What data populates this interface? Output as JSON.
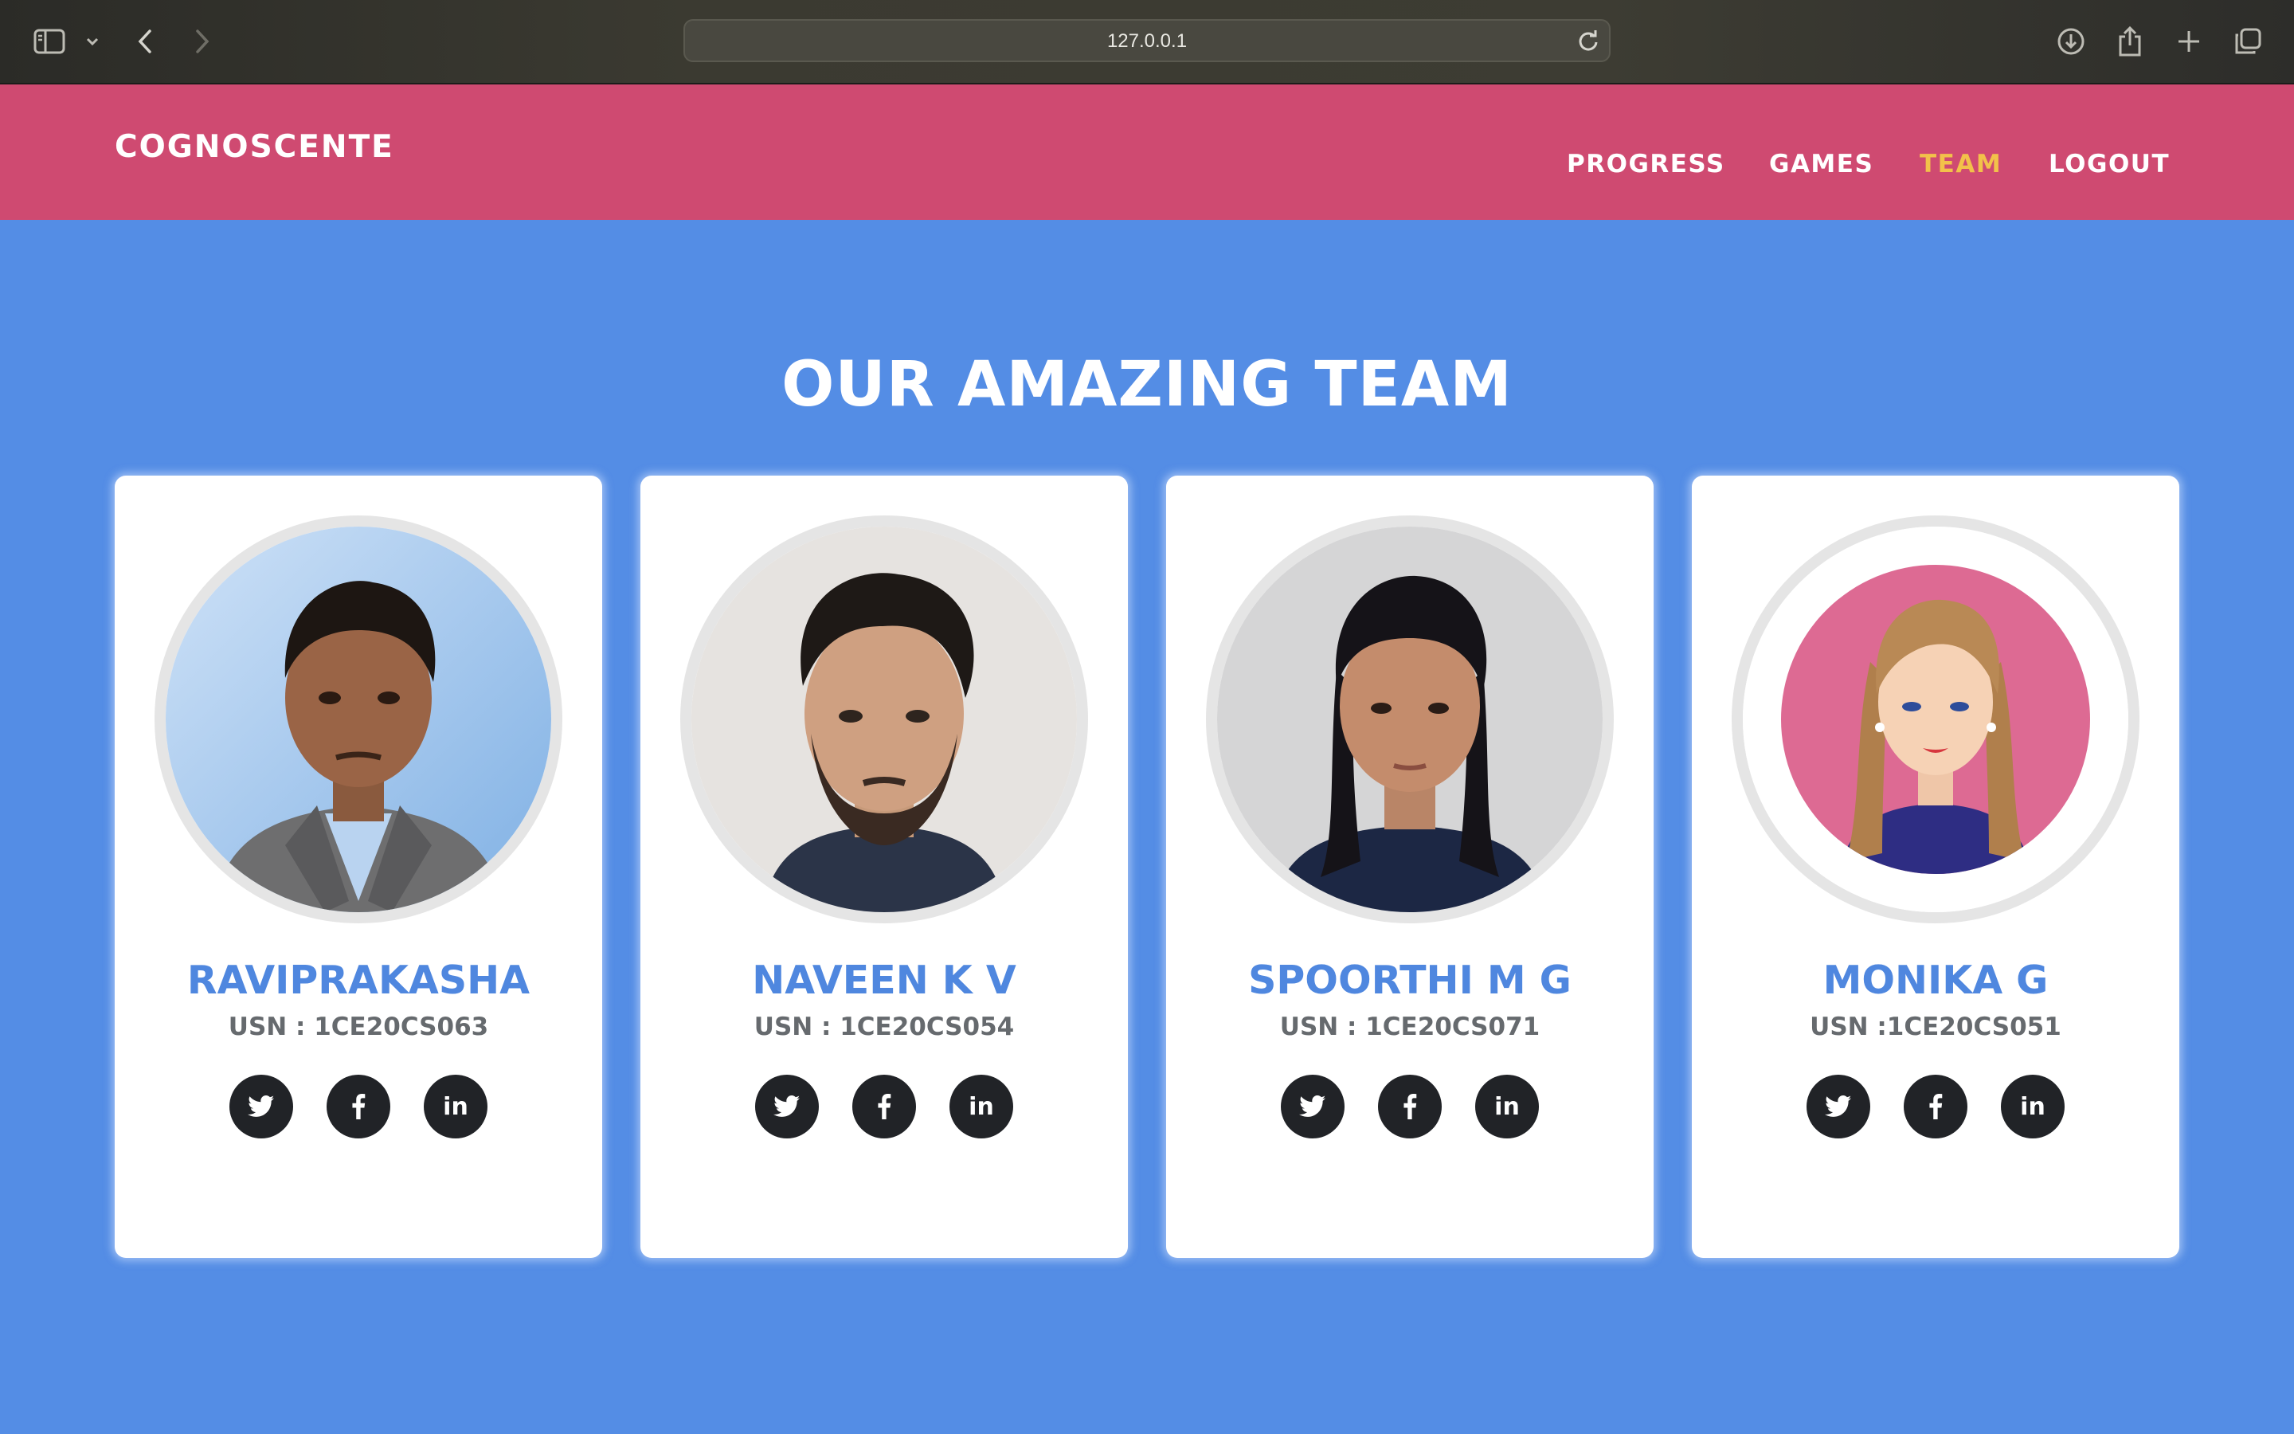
{
  "browser": {
    "url": "127.0.0.1",
    "icons": [
      "sidebar-icon",
      "chevron-down-icon",
      "back-icon",
      "forward-icon",
      "reload-icon",
      "download-icon",
      "share-icon",
      "new-tab-icon",
      "tabs-overview-icon"
    ]
  },
  "header": {
    "brand": "COGNOSCENTE",
    "nav": [
      {
        "label": "PROGRESS",
        "active": false
      },
      {
        "label": "GAMES",
        "active": false
      },
      {
        "label": "TEAM",
        "active": true
      },
      {
        "label": "LOGOUT",
        "active": false
      }
    ]
  },
  "section": {
    "title": "OUR AMAZING TEAM"
  },
  "team": [
    {
      "name": "RAVIPRAKASHA",
      "usn": "USN : 1CE20CS063",
      "photo": "photo-man-in-suit"
    },
    {
      "name": "NAVEEN K V",
      "usn": "USN : 1CE20CS054",
      "photo": "photo-young-man"
    },
    {
      "name": "SPOORTHI M G",
      "usn": "USN : 1CE20CS071",
      "photo": "photo-young-woman"
    },
    {
      "name": "MONIKA G",
      "usn": "USN :1CE20CS051",
      "photo": "cartoon-woman-avatar"
    }
  ],
  "social": {
    "twitter": "twitter-icon",
    "facebook": "facebook-icon",
    "linkedin": "in"
  },
  "colors": {
    "header_bg": "#cf4a71",
    "page_bg": "#548de5",
    "active_nav": "#f2c14a",
    "member_name": "#4f87df",
    "social_bg": "#212327"
  }
}
